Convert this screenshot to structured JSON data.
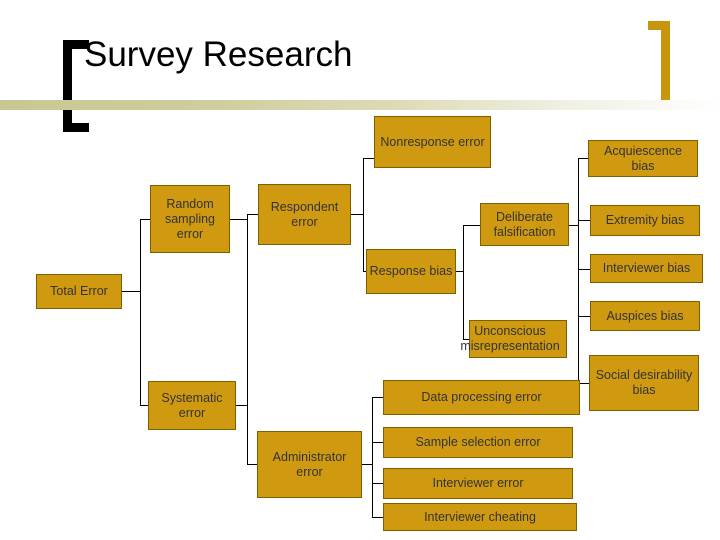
{
  "header": {
    "title": "Survey Research",
    "bracket_left_color": "#000000",
    "bracket_right_color": "#C8960C",
    "rule_color_start": "#c9c791",
    "rule_color_end": "#ffffff"
  },
  "theme": {
    "node_fill": "#CF9A10",
    "node_border": "#7F6000",
    "node_text": "#333333",
    "connector": "#000000",
    "background": "#ffffff"
  },
  "diagram": {
    "type": "tree",
    "root": "Total Error",
    "nodes": [
      {
        "id": "total_error",
        "label": "Total Error"
      },
      {
        "id": "random_sampling",
        "label": "Random sampling error"
      },
      {
        "id": "systematic",
        "label": "Systematic error"
      },
      {
        "id": "respondent",
        "label": "Respondent error"
      },
      {
        "id": "administrator",
        "label": "Administrator error"
      },
      {
        "id": "nonresponse",
        "label": "Nonresponse error"
      },
      {
        "id": "response_bias",
        "label": "Response bias"
      },
      {
        "id": "deliberate",
        "label": "Deliberate falsification"
      },
      {
        "id": "unconscious",
        "label": "Unconscious misrepresentation"
      },
      {
        "id": "acquiescence",
        "label": "Acquiescence bias"
      },
      {
        "id": "extremity",
        "label": "Extremity bias"
      },
      {
        "id": "interviewer_bias",
        "label": "Interviewer bias"
      },
      {
        "id": "auspices",
        "label": "Auspices bias"
      },
      {
        "id": "social_desirability",
        "label": "Social desirability bias"
      },
      {
        "id": "data_processing",
        "label": "Data processing error"
      },
      {
        "id": "sample_selection",
        "label": "Sample selection error"
      },
      {
        "id": "interviewer_error",
        "label": "Interviewer error"
      },
      {
        "id": "interviewer_cheat",
        "label": "Interviewer cheating"
      }
    ],
    "edges": [
      [
        "total_error",
        "random_sampling"
      ],
      [
        "total_error",
        "systematic"
      ],
      [
        "random_sampling",
        "respondent"
      ],
      [
        "systematic",
        "administrator"
      ],
      [
        "respondent",
        "nonresponse"
      ],
      [
        "respondent",
        "response_bias"
      ],
      [
        "response_bias",
        "deliberate"
      ],
      [
        "response_bias",
        "unconscious"
      ],
      [
        "deliberate",
        "acquiescence"
      ],
      [
        "deliberate",
        "extremity"
      ],
      [
        "deliberate",
        "interviewer_bias"
      ],
      [
        "deliberate",
        "auspices"
      ],
      [
        "deliberate",
        "social_desirability"
      ],
      [
        "administrator",
        "data_processing"
      ],
      [
        "administrator",
        "sample_selection"
      ],
      [
        "administrator",
        "interviewer_error"
      ],
      [
        "administrator",
        "interviewer_cheat"
      ]
    ]
  },
  "labels": {
    "total_error": "Total Error",
    "random_sampling": "Random sampling error",
    "systematic": "Systematic error",
    "respondent": "Respondent error",
    "administrator": "Administrator error",
    "nonresponse": "Nonresponse error",
    "response_bias": "Response bias",
    "deliberate": "Deliberate falsification",
    "unconscious": "Unconscious misrepresentation",
    "acquiescence": "Acquiescence bias",
    "extremity": "Extremity bias",
    "interviewer_bias": "Interviewer bias",
    "auspices": "Auspices bias",
    "social_desirability": "Social desirability bias",
    "data_processing": "Data processing error",
    "sample_selection": "Sample selection error",
    "interviewer_error": "Interviewer error",
    "interviewer_cheat": "Interviewer cheating"
  }
}
